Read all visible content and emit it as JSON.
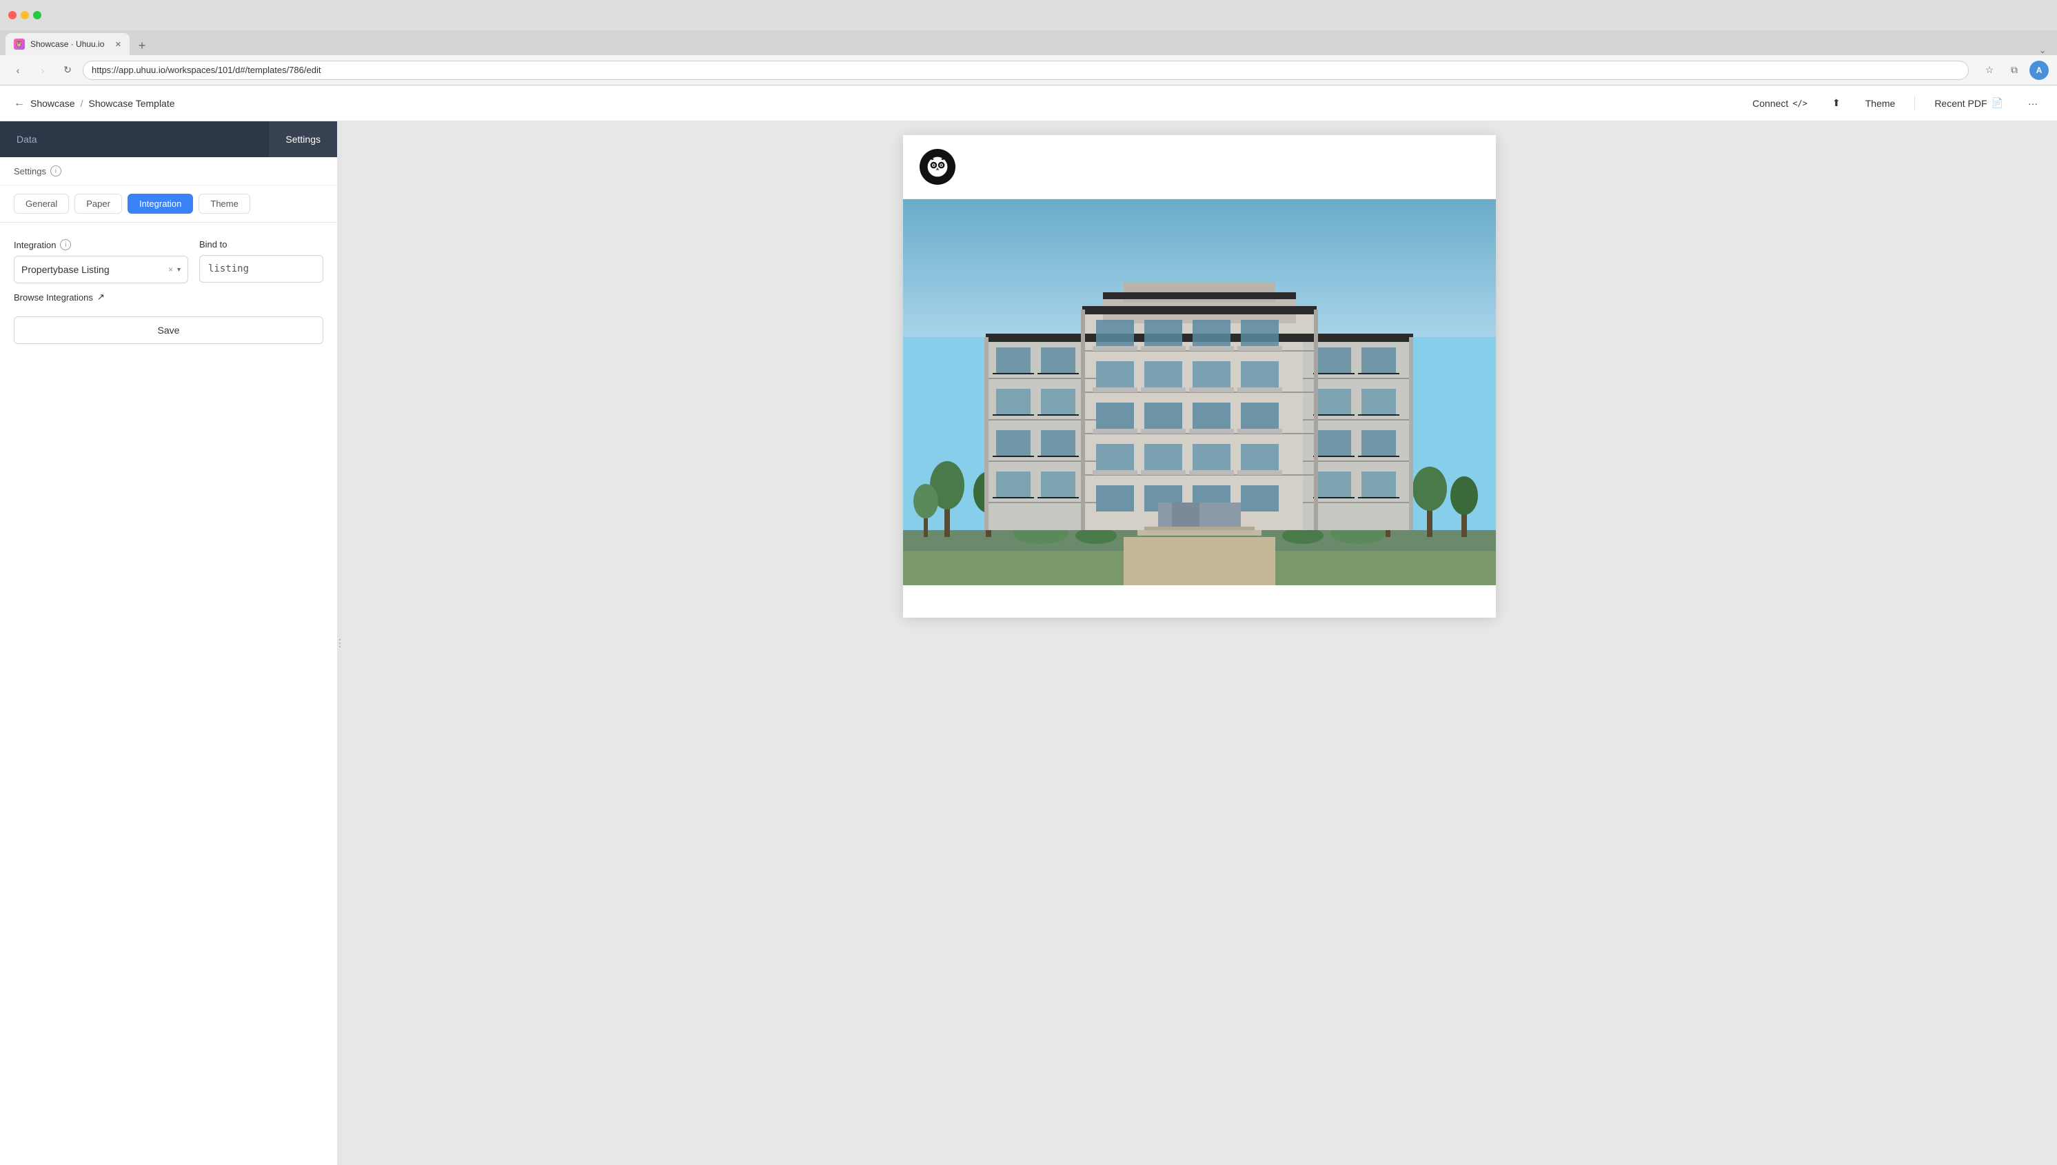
{
  "browser": {
    "url": "https://app.uhuu.io/workspaces/101/d#/templates/786/edit",
    "tab_title": "Showcase · Uhuu.io",
    "tab_favicon": "U"
  },
  "header": {
    "back_label": "←",
    "breadcrumb_root": "Showcase",
    "breadcrumb_sep": "/",
    "breadcrumb_current": "Showcase Template",
    "connect_label": "Connect",
    "connect_code": "</>",
    "upload_icon": "⬆",
    "theme_label": "Theme",
    "recent_pdf_label": "Recent PDF",
    "pdf_icon": "⬇",
    "more_icon": "···"
  },
  "left_panel": {
    "tab_data": "Data",
    "tab_settings": "Settings",
    "settings_label": "Settings",
    "settings_info_icon": "i",
    "sub_tabs": [
      "General",
      "Paper",
      "Integration",
      "Theme"
    ],
    "active_sub_tab": "Integration",
    "integration_label": "Integration",
    "bind_to_label": "Bind to",
    "integration_value": "Propertybase Listing",
    "bind_to_value": "listing",
    "browse_integrations_label": "Browse Integrations",
    "browse_icon": "↗",
    "save_label": "Save",
    "clear_icon": "×",
    "dropdown_icon": "▾"
  },
  "preview": {
    "logo_emoji": "🦉"
  }
}
